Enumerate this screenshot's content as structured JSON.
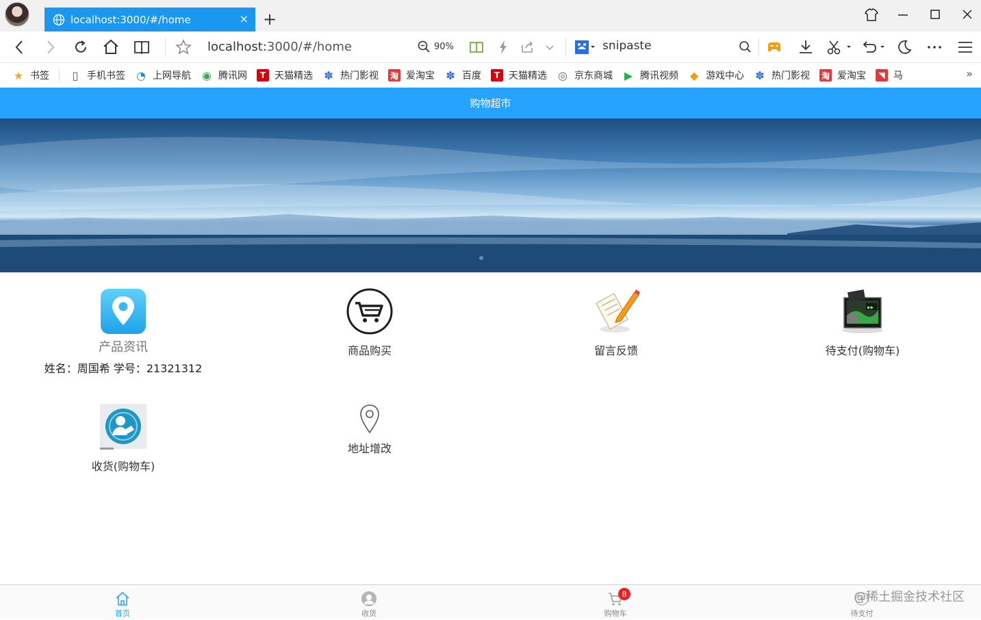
{
  "browser": {
    "tab_title": "localhost:3000/#/home",
    "tab_close": "×",
    "new_tab": "+",
    "url_host": "localhost:",
    "url_path": "3000/#/home",
    "zoom": "90%",
    "search_engine": "snipaste"
  },
  "bookmarks": [
    {
      "label": "书签",
      "icon": "star-icon",
      "color": "#f5a623"
    },
    {
      "label": "手机书签",
      "icon": "phone-icon",
      "color": "#555555"
    },
    {
      "label": "上网导航",
      "icon": "navigation-icon",
      "color": "#1e88e5"
    },
    {
      "label": "腾讯网",
      "icon": "tencent-icon",
      "color": "#34a853"
    },
    {
      "label": "天猫精选",
      "icon": "tmall-icon",
      "color": "#d7000f"
    },
    {
      "label": "热门影视",
      "icon": "paw-icon",
      "color": "#2b6de3"
    },
    {
      "label": "爱淘宝",
      "icon": "taobao-icon",
      "color": "#e4393c"
    },
    {
      "label": "百度",
      "icon": "paw-icon",
      "color": "#2b6de3"
    },
    {
      "label": "天猫精选",
      "icon": "tmall-icon",
      "color": "#d7000f"
    },
    {
      "label": "京东商城",
      "icon": "globe-icon",
      "color": "#666666"
    },
    {
      "label": "腾讯视频",
      "icon": "video-icon",
      "color": "#22b14c"
    },
    {
      "label": "游戏中心",
      "icon": "gamepad-icon",
      "color": "#f39c12"
    },
    {
      "label": "热门影视",
      "icon": "paw-icon",
      "color": "#2b6de3"
    },
    {
      "label": "爱淘宝",
      "icon": "taobao-icon",
      "color": "#e4393c"
    },
    {
      "label": "马",
      "icon": "ma-icon",
      "color": "#e4393c"
    }
  ],
  "app": {
    "header_title": "购物超市",
    "accent": "#26a2ff",
    "grid": [
      {
        "label": "产品资讯",
        "icon": "location-pin-icon"
      },
      {
        "label": "商品购买",
        "icon": "cart-icon"
      },
      {
        "label": "留言反馈",
        "icon": "notepad-pencil-icon"
      },
      {
        "label": "待支付(购物车)",
        "icon": "film-screen-icon"
      },
      {
        "label": "收货(购物车)",
        "icon": "user-delivery-icon"
      },
      {
        "label": "地址增改",
        "icon": "map-marker-icon"
      }
    ],
    "student_info": "姓名：周国希 学号：21321312",
    "tabbar": [
      {
        "label": "首页",
        "icon": "home-icon"
      },
      {
        "label": "收货",
        "icon": "user-icon"
      },
      {
        "label": "购物车",
        "icon": "cart-icon",
        "badge": "8"
      },
      {
        "label": "待支付",
        "icon": "pay-icon"
      }
    ]
  },
  "watermark": "@稀土掘金技术社区"
}
